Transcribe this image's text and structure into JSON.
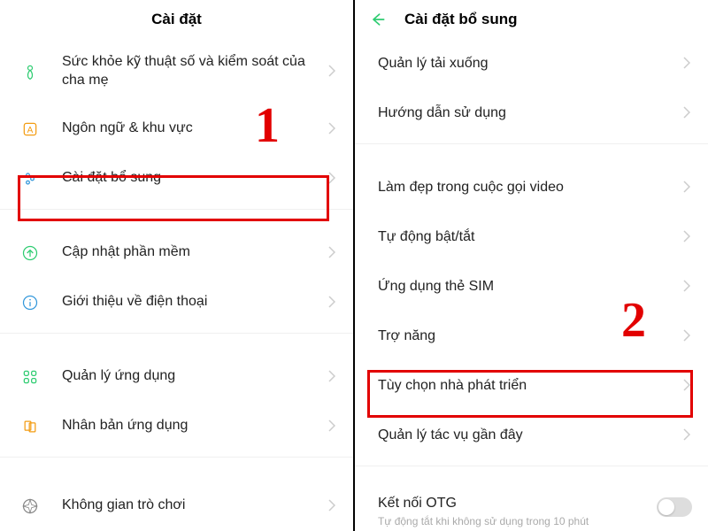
{
  "annotations": {
    "num1": "1",
    "num2": "2"
  },
  "left": {
    "title": "Cài đặt",
    "rows": [
      {
        "icon": "health",
        "label": "Sức khỏe kỹ thuật số và kiểm soát của cha mẹ"
      },
      {
        "icon": "lang",
        "label": "Ngôn ngữ & khu vực"
      },
      {
        "icon": "more",
        "label": "Cài đặt bổ sung",
        "highlight": true
      },
      {
        "gap": true
      },
      {
        "icon": "update",
        "label": "Cập nhật phần mềm"
      },
      {
        "icon": "info",
        "label": "Giới thiệu về điện thoại"
      },
      {
        "gap": true
      },
      {
        "icon": "apps",
        "label": "Quản lý ứng dụng"
      },
      {
        "icon": "clone",
        "label": "Nhân bản ứng dụng"
      },
      {
        "gap": true
      },
      {
        "icon": "game",
        "label": "Không gian trò chơi"
      }
    ]
  },
  "right": {
    "title": "Cài đặt bổ sung",
    "rows": [
      {
        "label": "Quản lý tải xuống"
      },
      {
        "label": "Hướng dẫn sử dụng"
      },
      {
        "gap": true
      },
      {
        "label": "Làm đẹp trong cuộc gọi video"
      },
      {
        "label": "Tự động bật/tắt"
      },
      {
        "label": "Ứng dụng thẻ SIM"
      },
      {
        "label": "Trợ năng"
      },
      {
        "label": "Tùy chọn nhà phát triển",
        "highlight": true
      },
      {
        "label": "Quản lý tác vụ gần đây"
      }
    ],
    "otg": {
      "title": "Kết nối OTG",
      "sub": "Tự động tắt khi không sử dụng trong 10 phút"
    }
  },
  "colors": {
    "accent": "#2ecc71",
    "highlight": "#e20000"
  }
}
